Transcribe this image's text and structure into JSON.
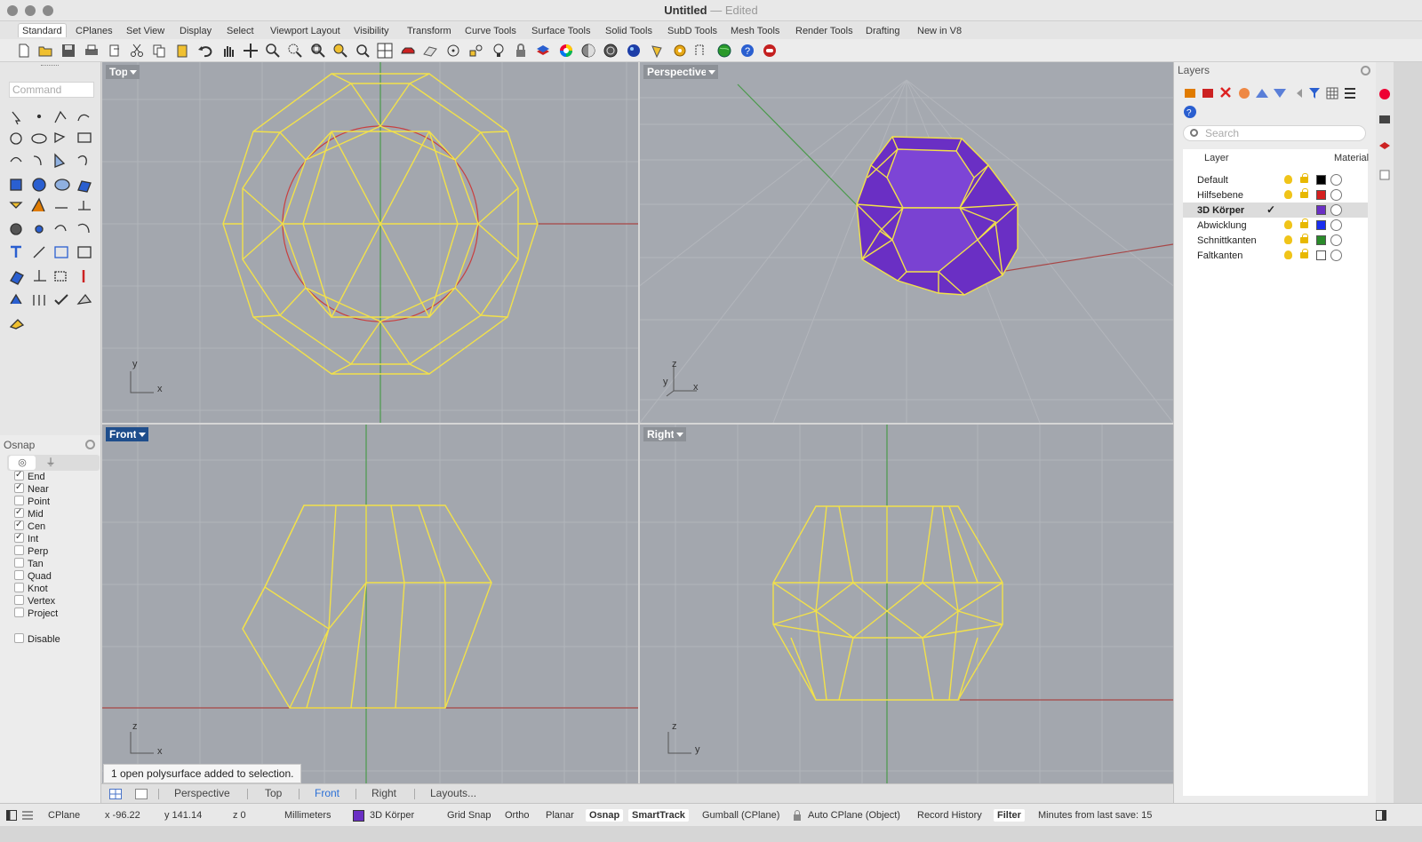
{
  "window": {
    "title": "Untitled",
    "dash": "—",
    "state": "Edited"
  },
  "menu_tabs": [
    "Standard",
    "CPlanes",
    "Set View",
    "Display",
    "Select",
    "Viewport Layout",
    "Visibility",
    "Transform",
    "Curve Tools",
    "Surface Tools",
    "Solid Tools",
    "SubD Tools",
    "Mesh Tools",
    "Render Tools",
    "Drafting",
    "New in V8"
  ],
  "command": {
    "placeholder": "Command"
  },
  "osnap": {
    "title": "Osnap",
    "items": [
      {
        "label": "End",
        "checked": true
      },
      {
        "label": "Near",
        "checked": true
      },
      {
        "label": "Point",
        "checked": false
      },
      {
        "label": "Mid",
        "checked": true
      },
      {
        "label": "Cen",
        "checked": true
      },
      {
        "label": "Int",
        "checked": true
      },
      {
        "label": "Perp",
        "checked": false
      },
      {
        "label": "Tan",
        "checked": false
      },
      {
        "label": "Quad",
        "checked": false
      },
      {
        "label": "Knot",
        "checked": false
      },
      {
        "label": "Vertex",
        "checked": false
      },
      {
        "label": "Project",
        "checked": false
      }
    ],
    "disable": "Disable"
  },
  "viewports": {
    "top": {
      "label": "Top",
      "axis_a": "y",
      "axis_b": "x"
    },
    "perspective": {
      "label": "Perspective",
      "axis_a": "z",
      "axis_b": "y",
      "axis_c": "x"
    },
    "front": {
      "label": "Front",
      "axis_a": "z",
      "axis_b": "x"
    },
    "right": {
      "label": "Right",
      "axis_a": "z",
      "axis_b": "y"
    }
  },
  "layers": {
    "title": "Layers",
    "search_placeholder": "Search",
    "col_layer": "Layer",
    "col_material": "Material",
    "current_mark": "✓",
    "rows": [
      {
        "name": "Default",
        "color": "#000000",
        "current": false
      },
      {
        "name": "Hilfsebene",
        "color": "#d42020",
        "current": false
      },
      {
        "name": "3D Körper",
        "color": "#6a2fc4",
        "current": true
      },
      {
        "name": "Abwicklung",
        "color": "#1a2ef0",
        "current": false
      },
      {
        "name": "Schnittkanten",
        "color": "#2a8a2a",
        "current": false
      },
      {
        "name": "Faltkanten",
        "color": "#ffffff",
        "current": false
      }
    ]
  },
  "viewport_tabs": [
    "Perspective",
    "Top",
    "Front",
    "Right",
    "Layouts..."
  ],
  "toast": "1 open polysurface added to selection.",
  "status": {
    "cplane": "CPlane",
    "x": "x -96.22",
    "y": "y 141.14",
    "z": "z 0",
    "units": "Millimeters",
    "layer": "3D Körper",
    "layer_color": "#6a2fc4",
    "grid_snap": "Grid Snap",
    "ortho": "Ortho",
    "planar": "Planar",
    "osnap": "Osnap",
    "smarttrack": "SmartTrack",
    "gumball": "Gumball (CPlane)",
    "auto_cplane": "Auto CPlane (Object)",
    "record_history": "Record History",
    "filter": "Filter",
    "minutes": "Minutes from last save: 15"
  },
  "colors": {
    "wire": "#f2e14a",
    "solid": "#6a2fc4",
    "viewport_bg": "#a3a7ae"
  }
}
